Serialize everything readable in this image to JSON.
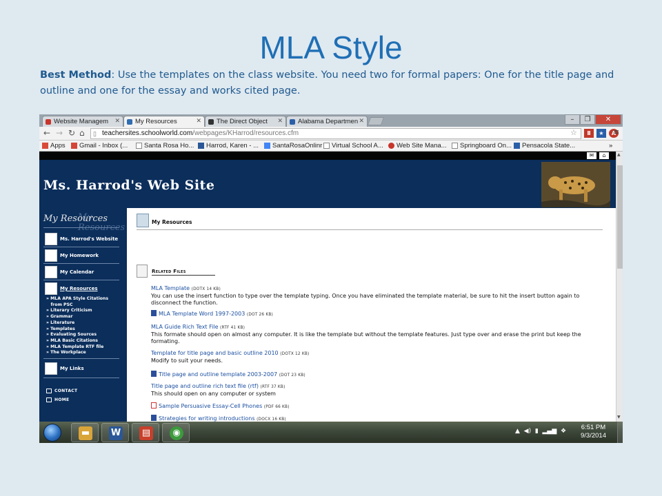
{
  "slide": {
    "title": "MLA Style",
    "body_bold": "Best Method",
    "body_text": ": Use the templates on the class website. You need two for formal papers: One for the title page and outline and one for the essay and works cited page."
  },
  "browser": {
    "tabs": [
      {
        "label": "Website Managem",
        "fav_color": "#c8352b"
      },
      {
        "label": "My Resources",
        "fav_color": "#2f6db0"
      },
      {
        "label": "The Direct Object",
        "fav_color": "#333333"
      },
      {
        "label": "Alabama Departmen",
        "fav_color": "#2a5fa8"
      }
    ],
    "url_host": "teachersites.schoolworld.com",
    "url_path": "/webpages/KHarrod/resources.cfm",
    "bookmarks": [
      {
        "label": "Apps",
        "color": "#d94a38"
      },
      {
        "label": "Gmail - Inbox (...",
        "color": "#d44638"
      },
      {
        "label": "Santa Rosa Ho...",
        "color": "#888888"
      },
      {
        "label": "Harrod, Karen - ...",
        "color": "#2b5797"
      },
      {
        "label": "SantaRosaOnlinr",
        "color": "#4285f4"
      },
      {
        "label": "Virtual School A...",
        "color": "#888888"
      },
      {
        "label": "Web Site Mana...",
        "color": "#c8352b"
      },
      {
        "label": "Springboard On...",
        "color": "#888888"
      },
      {
        "label": "Pensacola State...",
        "color": "#2a5fa8"
      }
    ],
    "overflow": "»"
  },
  "site": {
    "title": "Ms. Harrod's Web Site",
    "sidebar_heading": "My Resources",
    "nav": [
      {
        "label": "Ms. Harrod's Website"
      },
      {
        "label": "My Homework"
      },
      {
        "label": "My Calendar"
      },
      {
        "label": "My Resources"
      }
    ],
    "sub_links": [
      "» MLA APA Style Citations",
      "   from PSC",
      "» Literary Criticism",
      "» Grammar",
      "» Literature",
      "» Templates",
      "» Evaluating Sources",
      "» MLA Basic Citations",
      "» MLA Template RTF file",
      "» The Workplace"
    ],
    "my_links": "My Links",
    "contact": "Contact",
    "home": "Home",
    "page_title": "My Resources",
    "related_files": "Related Files",
    "files": [
      {
        "name": "MLA Template",
        "meta": "(DOTX 14 KB)",
        "desc": "You can use the insert function to type over the template typing. Once you have eliminated the template material, be sure to hit the insert button again to disconnect the function.",
        "icon": ""
      },
      {
        "name": "MLA Template Word 1997-2003",
        "meta": "(DOT 26 KB)",
        "desc": "",
        "icon": "doc"
      },
      {
        "name": "MLA Guide Rich Text File",
        "meta": "(RTF 41 KB)",
        "desc": "This formate should open on almost any computer. It is like the template but without the template features. Just type over and erase the print but keep the formating.",
        "icon": ""
      },
      {
        "name": "Template for title page and basic outline 2010",
        "meta": "(DOTX 12 KB)",
        "desc": "Modify to suit your needs.",
        "icon": ""
      },
      {
        "name": "Title page and outline template 2003-2007",
        "meta": "(DOT 23 KB)",
        "desc": "",
        "icon": "doc"
      },
      {
        "name": "Title page and outline rich text file (rtf)",
        "meta": "(RTF 37 KB)",
        "desc": "This should open on any computer or system",
        "icon": ""
      },
      {
        "name": "Sample Persuasive Essay-Cell Phones",
        "meta": "(PDF 66 KB)",
        "desc": "",
        "icon": "pdf"
      },
      {
        "name": "Strategies for writing introductions",
        "meta": "(DOCX 16 KB)",
        "desc": "",
        "icon": "doc"
      }
    ]
  },
  "taskbar": {
    "apps": [
      {
        "glyph": "▬",
        "color": "#d9a43a"
      },
      {
        "glyph": "W",
        "color": "#2b5797"
      },
      {
        "glyph": "▤",
        "color": "#c8402b"
      },
      {
        "glyph": "◉",
        "color": "#3c9a3c"
      }
    ],
    "time": "6:51 PM",
    "date": "9/3/2014"
  }
}
